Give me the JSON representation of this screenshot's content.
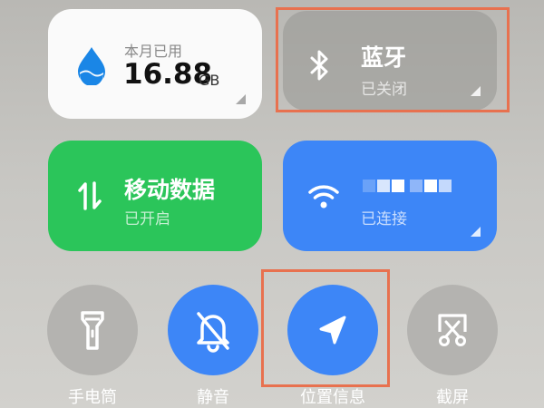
{
  "data_tile": {
    "label": "本月已用",
    "value": "16.88",
    "unit": "GB",
    "icon": "water-drop-icon"
  },
  "bluetooth_tile": {
    "title": "蓝牙",
    "status": "已关闭",
    "icon": "bluetooth-icon"
  },
  "mobile_data_tile": {
    "title": "移动数据",
    "status": "已开启",
    "icon": "data-transfer-arrows-icon"
  },
  "wifi_tile": {
    "status": "已连接",
    "icon": "wifi-icon"
  },
  "quick_toggles": [
    {
      "label": "手电筒",
      "icon": "flashlight-icon",
      "active": false
    },
    {
      "label": "静音",
      "icon": "bell-muted-icon",
      "active": true
    },
    {
      "label": "位置信息",
      "icon": "location-arrow-icon",
      "active": true
    },
    {
      "label": "截屏",
      "icon": "screenshot-scissors-icon",
      "active": false
    }
  ],
  "colors": {
    "active_blue": "#3d86f7",
    "green": "#2bc55a",
    "highlight": "#e8714f",
    "data_tile_bg": "#fafafa",
    "inactive_gray": "#b4b3b0"
  }
}
